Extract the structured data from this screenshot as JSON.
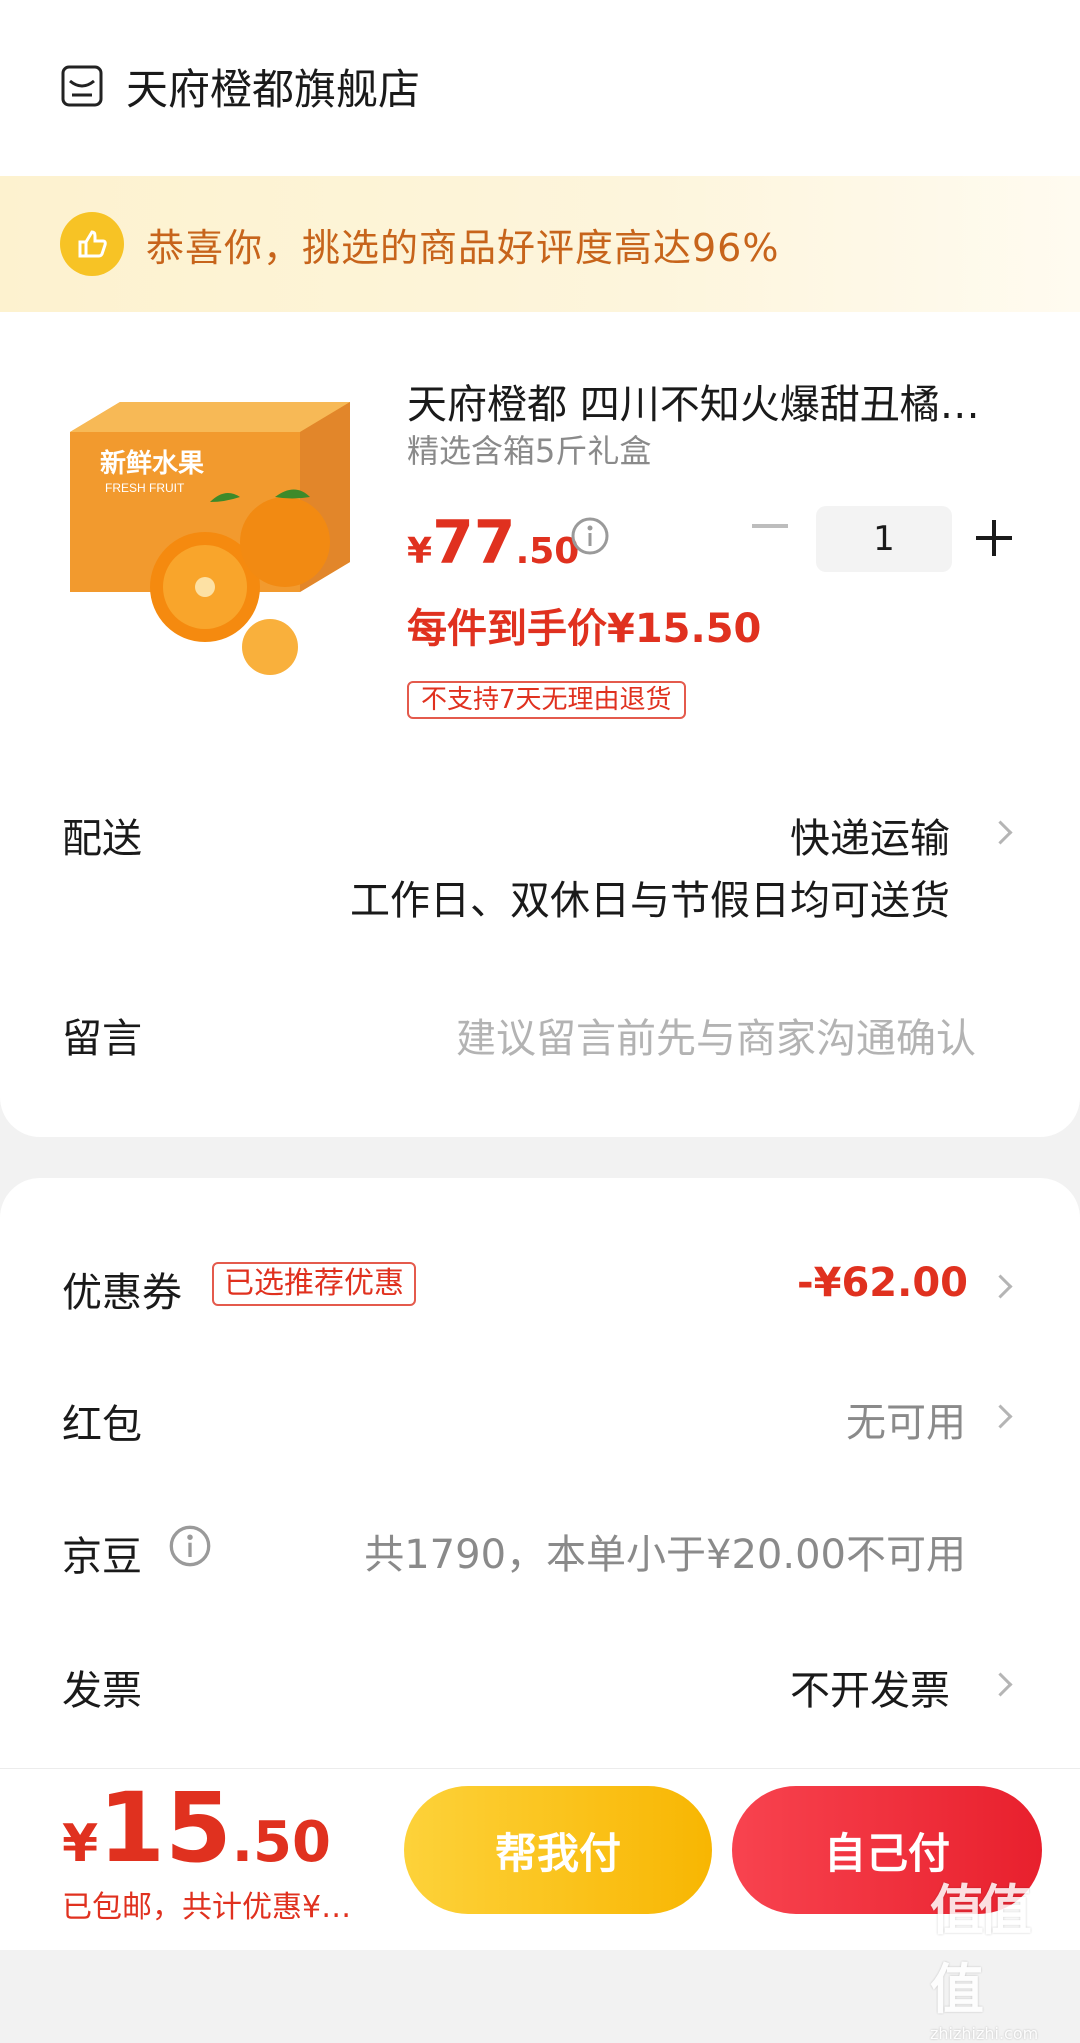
{
  "store": {
    "name": "天府橙都旗舰店",
    "icon": "store-icon"
  },
  "banner": {
    "text": "恭喜你，挑选的商品好评度高达96%",
    "icon": "thumbs-up-icon"
  },
  "product": {
    "title": "天府橙都 四川不知火爆甜丑橘",
    "spec": "精选含箱5斤礼盒",
    "price_currency": "¥",
    "price_int": "77",
    "price_dec": ".50",
    "quantity": "1",
    "per_price": "每件到手价¥15.50",
    "return_policy": "不支持7天无理由退货",
    "image_box_text": "新鲜水果",
    "image_box_subtext": "FRESH FRUIT"
  },
  "delivery": {
    "label": "配送",
    "method": "快递运输",
    "note": "工作日、双休日与节假日均可送货"
  },
  "message": {
    "label": "留言",
    "placeholder": "建议留言前先与商家沟通确认"
  },
  "coupon": {
    "label": "优惠券",
    "tag": "已选推荐优惠",
    "value": "-¥62.00"
  },
  "redpacket": {
    "label": "红包",
    "value": "无可用"
  },
  "jingdou": {
    "label": "京豆",
    "value": "共1790，本单小于¥20.00不可用"
  },
  "invoice": {
    "label": "发票",
    "value": "不开发票"
  },
  "footer": {
    "total_currency": "¥",
    "total_int": "15",
    "total_dec": ".50",
    "shipping_note": "已包邮，共计优惠¥…",
    "help_pay": "帮我付",
    "self_pay": "自己付"
  },
  "watermark": {
    "glyph": "值值值",
    "site": "zhizhizhi.com"
  },
  "colors": {
    "accent_red": "#e0311f",
    "banner_text": "#c7641b",
    "help_pay": "#f8b602",
    "self_pay": "#e8202d"
  }
}
